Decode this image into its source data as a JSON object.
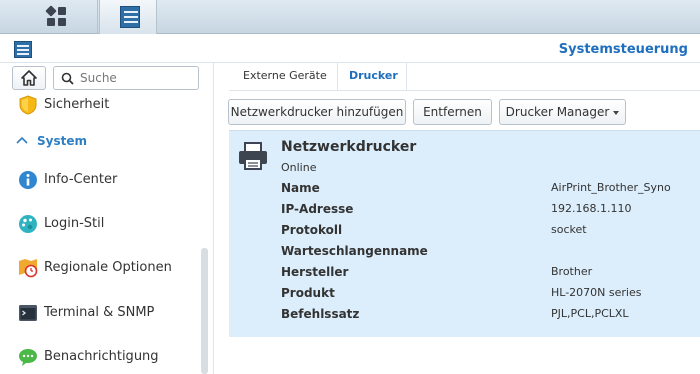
{
  "window": {
    "title": "Systemsteuerung"
  },
  "sidebar": {
    "search_placeholder": "Suche",
    "items": [
      {
        "label": "Sicherheit",
        "icon": "shield-icon"
      },
      {
        "label": "Info-Center",
        "icon": "info-icon"
      },
      {
        "label": "Login-Stil",
        "icon": "palette-icon"
      },
      {
        "label": "Regionale Optionen",
        "icon": "regional-clock-icon"
      },
      {
        "label": "Terminal & SNMP",
        "icon": "terminal-icon"
      },
      {
        "label": "Benachrichtigung",
        "icon": "chat-bubble-icon"
      }
    ],
    "section": {
      "label": "System"
    }
  },
  "tabs": [
    {
      "label": "Externe Geräte"
    },
    {
      "label": "Drucker"
    }
  ],
  "toolbar": {
    "add_label": "Netzwerkdrucker hinzufügen",
    "remove_label": "Entfernen",
    "manager_label": "Drucker Manager"
  },
  "printer": {
    "name": "Netzwerkdrucker",
    "status": "Online",
    "properties": [
      {
        "key": "Name",
        "value": "AirPrint_Brother_Syno"
      },
      {
        "key": "IP-Adresse",
        "value": "192.168.1.110"
      },
      {
        "key": "Protokoll",
        "value": "socket"
      },
      {
        "key": "Warteschlangenname",
        "value": ""
      },
      {
        "key": "Hersteller",
        "value": "Brother"
      },
      {
        "key": "Produkt",
        "value": "HL-2070N series"
      },
      {
        "key": "Befehlssatz",
        "value": "PJL,PCL,PCLXL"
      }
    ]
  },
  "colors": {
    "accent": "#1e6fbe",
    "panel": "#dceefb"
  }
}
